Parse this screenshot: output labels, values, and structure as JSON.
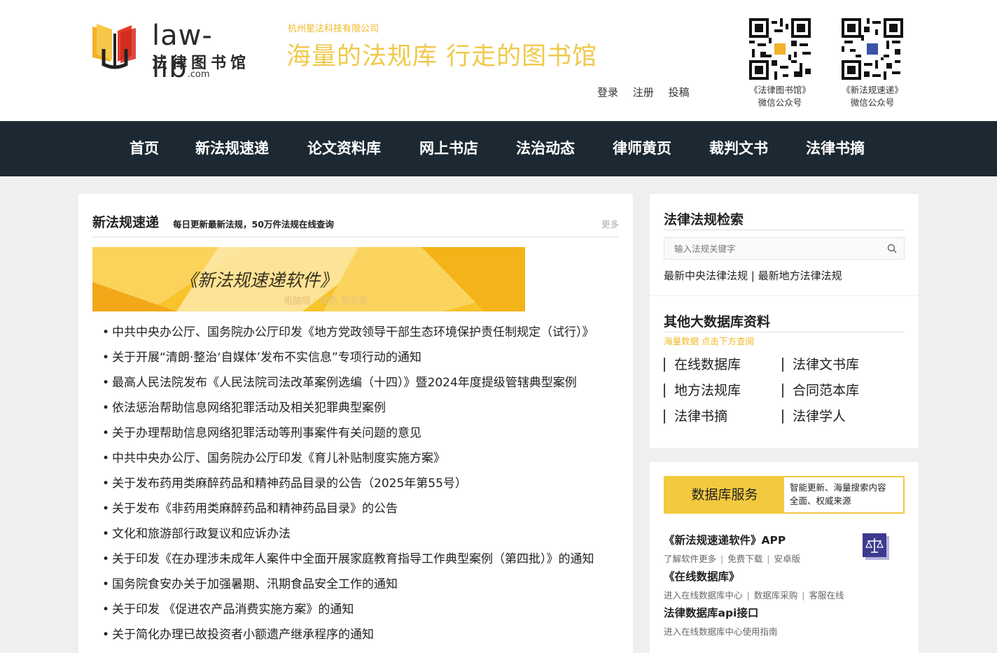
{
  "header": {
    "logo_en": "law-lib",
    "logo_dom": ".com",
    "logo_cn": "法律图书馆",
    "company": "杭州星法科技有限公司",
    "slogan": "海量的法规库  行走的图书馆",
    "links": [
      "登录",
      "注册",
      "投稿"
    ],
    "qr1": {
      "line1": "《法律图书馆》",
      "line2": "微信公众号"
    },
    "qr2": {
      "line1": "《新法规速递》",
      "line2": "微信公众号"
    }
  },
  "nav": {
    "items": [
      "首页",
      "新法规速递",
      "论文资料库",
      "网上书店",
      "法治动态",
      "律师黄页",
      "裁判文书",
      "法律书摘"
    ]
  },
  "main": {
    "title": "新法规速递",
    "subtitle": "每日更新最新法规，50万件法规在线查询",
    "more": "更多",
    "banner_title": "《新法规速递软件》",
    "banner_sub": "电脑版 : 绿色 免安装",
    "news": [
      "中共中央办公厅、国务院办公厅印发《地方党政领导干部生态环境保护责任制规定（试行）》",
      "关于开展“清朗·整治‘自媒体’发布不实信息”专项行动的通知",
      "最高人民法院发布《人民法院司法改革案例选编（十四）》暨2024年度提级管辖典型案例",
      "依法惩治帮助信息网络犯罪活动及相关犯罪典型案例",
      "关于办理帮助信息网络犯罪活动等刑事案件有关问题的意见",
      "中共中央办公厅、国务院办公厅印发《育儿补贴制度实施方案》",
      "关于发布药用类麻醉药品和精神药品目录的公告（2025年第55号）",
      "关于发布《非药用类麻醉药品和精神药品目录》的公告",
      "文化和旅游部行政复议和应诉办法",
      "关于印发《在办理涉未成年人案件中全面开展家庭教育指导工作典型案例（第四批）》的通知",
      "国务院食安办关于加强暑期、汛期食品安全工作的通知",
      "关于印发 《促进农产品消费实施方案》的通知",
      "关于简化办理已故投资者小额遗产继承程序的通知"
    ]
  },
  "search_panel": {
    "title": "法律法规检索",
    "placeholder": "输入法规关键字",
    "link1": "最新中央法律法规",
    "divider": " | ",
    "link2": "最新地方法律法规"
  },
  "db_panel": {
    "title": "其他大数据库资料",
    "note": "海量数据 点击下方查阅",
    "items": [
      "在线数据库",
      "法律文书库",
      "地方法规库",
      "合同范本库",
      "法律书摘",
      "法律学人"
    ]
  },
  "service_panel": {
    "box_left": "数据库服务",
    "box_right_1": "智能更新、海量搜索内容",
    "box_right_2": "全面、权威来源",
    "app_title": "《新法规速递软件》APP",
    "app_links": [
      "了解软件更多",
      "免费下载",
      "安卓版"
    ],
    "online_title": "《在线数据库》",
    "online_links": [
      "进入在线数据库中心",
      "数据库采购",
      "客服在线"
    ],
    "api_title": "法律数据库api接口",
    "api_sub": "进入在线数据库中心使用指南",
    "sep": "|"
  },
  "colors": {
    "nav_bg": "#1c2932",
    "accent_yellow": "#f3c93e",
    "slogan": "#f0c94b",
    "company": "#f0b825"
  }
}
